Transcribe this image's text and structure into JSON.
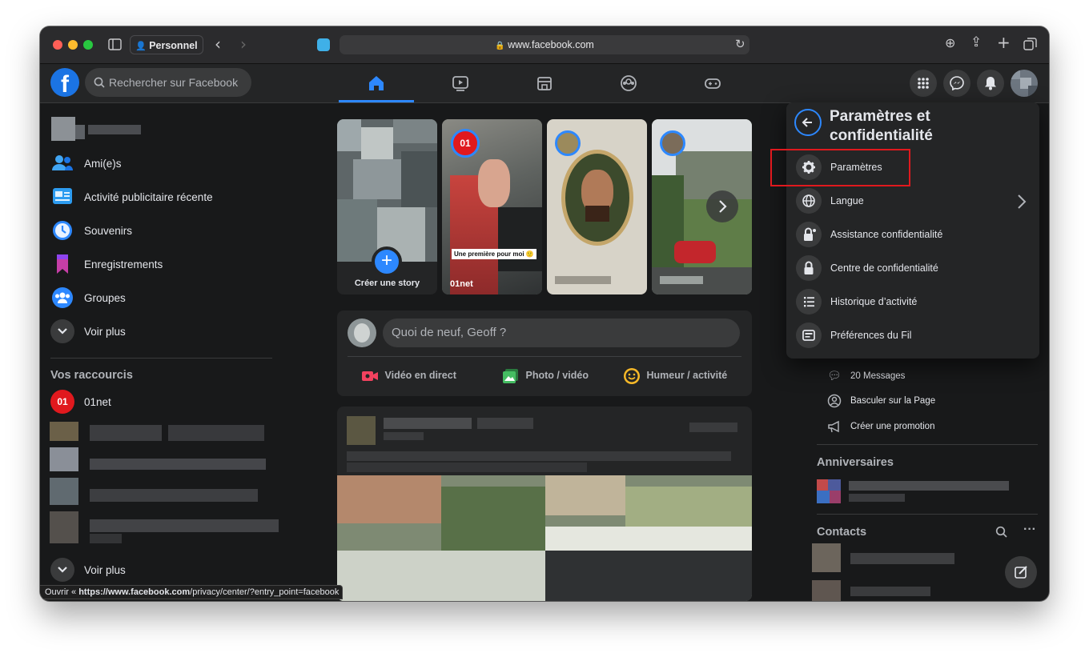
{
  "browser": {
    "profile_label": "Personnel",
    "url": "www.facebook.com",
    "traffic_lights": [
      "#ff5f57",
      "#febc2e",
      "#28c840"
    ]
  },
  "header": {
    "search_placeholder": "Rechercher sur Facebook",
    "brand_color": "#1b74e4"
  },
  "left_nav": {
    "items": [
      {
        "label": "Ami(e)s",
        "icon": "friends-icon"
      },
      {
        "label": "Activité publicitaire récente",
        "icon": "ad-activity-icon"
      },
      {
        "label": "Souvenirs",
        "icon": "clock-icon"
      },
      {
        "label": "Enregistrements",
        "icon": "bookmark-icon"
      },
      {
        "label": "Groupes",
        "icon": "groups-icon"
      },
      {
        "label": "Voir plus",
        "icon": "chevron-down-icon"
      }
    ],
    "shortcuts_title": "Vos raccourcis",
    "shortcut_01net": "01net",
    "shortcut_more": "Voir plus"
  },
  "stories": {
    "create_label": "Créer une story",
    "story2_name": "01net",
    "story2_caption": "Une première pour moi 🙂"
  },
  "composer": {
    "placeholder": "Quoi de neuf, Geoff ?",
    "live_label": "Vidéo en direct",
    "photo_label": "Photo / vidéo",
    "mood_label": "Humeur / activité"
  },
  "right_panel": {
    "messages": "20 Messages",
    "switch_page": "Basculer sur la Page",
    "promote": "Créer une promotion",
    "birthdays_title": "Anniversaires",
    "contacts_title": "Contacts"
  },
  "settings_menu": {
    "title_line1": "Paramètres et",
    "title_line2": "confidentialité",
    "items": [
      {
        "label": "Paramètres",
        "icon": "gear-icon",
        "highlighted": true
      },
      {
        "label": "Langue",
        "icon": "globe-icon"
      },
      {
        "label": "Assistance confidentialité",
        "icon": "lock-star-icon"
      },
      {
        "label": "Centre de confidentialité",
        "icon": "lock-icon"
      },
      {
        "label": "Historique d’activité",
        "icon": "list-icon"
      },
      {
        "label": "Préférences du Fil",
        "icon": "feed-icon"
      }
    ],
    "highlight_color": "#e0191e"
  },
  "status_bar": {
    "prefix": "Ouvrir « ",
    "host": "https://www.facebook.com",
    "path": "/privacy/center/?entry_point=facebook"
  }
}
